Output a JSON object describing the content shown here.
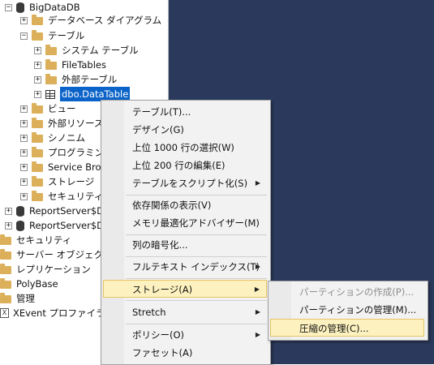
{
  "tree": {
    "database": "BigDataDB",
    "database_diagrams": "データベース ダイアグラム",
    "tables": "テーブル",
    "system_tables": "システム テーブル",
    "file_tables": "FileTables",
    "external_tables": "外部テーブル",
    "selected_table": "dbo.DataTable",
    "views": "ビュー",
    "external_resources": "外部リソース",
    "synonyms": "シノニム",
    "programmability": "プログラミング",
    "service_broker": "Service Brok",
    "storage": "ストレージ",
    "security_db": "セキュリティ",
    "report_server": "ReportServer$DI",
    "report_server_temp": "ReportServer$DI",
    "security": "セキュリティ",
    "server_objects": "サーバー オブジェクト",
    "replication": "レプリケーション",
    "polybase": "PolyBase",
    "management": "管理",
    "xevent_profiler": "XEvent プロファイラー",
    "expand_plus": "+",
    "expand_minus": "−",
    "xevent_glyph": "X"
  },
  "context_menu": {
    "items": [
      {
        "label": "テーブル(T)..."
      },
      {
        "label": "デザイン(G)"
      },
      {
        "label": "上位 1000 行の選択(W)"
      },
      {
        "label": "上位 200 行の編集(E)"
      },
      {
        "label": "テーブルをスクリプト化(S)"
      },
      {
        "label": "依存関係の表示(V)"
      },
      {
        "label": "メモリ最適化アドバイザー(M)"
      },
      {
        "label": "列の暗号化..."
      },
      {
        "label": "フルテキスト インデックス(T)"
      },
      {
        "label": "ストレージ(A)"
      },
      {
        "label": "Stretch"
      },
      {
        "label": "ポリシー(O)"
      },
      {
        "label": "ファセット(A)"
      }
    ],
    "arrow": "▶"
  },
  "submenu": {
    "items": [
      {
        "label": "パーティションの作成(P)...",
        "enabled": false
      },
      {
        "label": "パーティションの管理(M)...",
        "enabled": true
      },
      {
        "label": "圧縮の管理(C)...",
        "enabled": true
      }
    ]
  },
  "colors": {
    "dark_pane": "#2b3a5c",
    "selection": "#0b63c9",
    "menu_highlight": "#fdf2bf",
    "menu_highlight_border": "#e5c365"
  }
}
